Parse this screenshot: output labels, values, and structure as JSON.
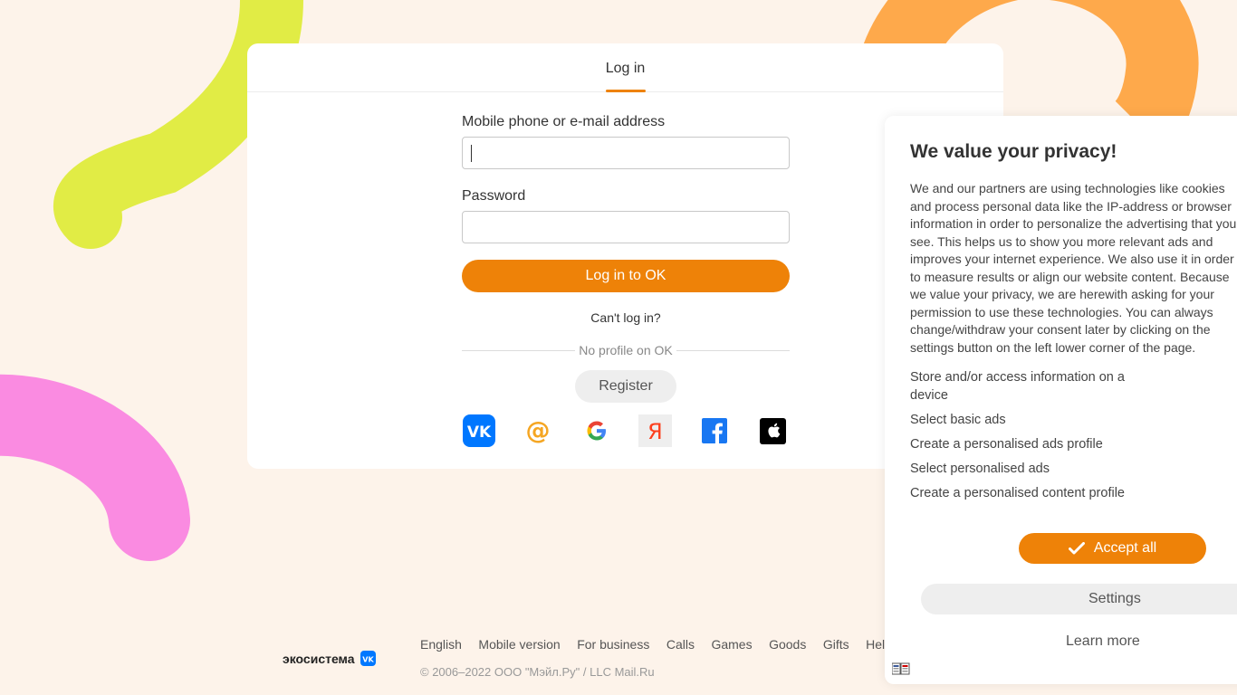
{
  "header": {
    "tab_login": "Log in"
  },
  "form": {
    "phone_label": "Mobile phone or e-mail address",
    "phone_value": "",
    "password_label": "Password",
    "password_value": "",
    "login_button": "Log in to OK",
    "cant_login": "Can't log in?",
    "no_profile": "No profile on OK",
    "register_button": "Register"
  },
  "socials": [
    {
      "name": "vk-icon",
      "color": "#0077ff"
    },
    {
      "name": "mail-at-icon",
      "color": "#f5a623"
    },
    {
      "name": "google-icon",
      "color": "#4285f4"
    },
    {
      "name": "yandex-icon",
      "color": "#fc3f1d"
    },
    {
      "name": "facebook-icon",
      "color": "#1877f2"
    },
    {
      "name": "apple-icon",
      "color": "#000000"
    }
  ],
  "footer": {
    "ecosystem": "экосистема",
    "links": [
      "English",
      "Mobile version",
      "For business",
      "Calls",
      "Games",
      "Goods",
      "Gifts",
      "Help"
    ],
    "copyright": "© 2006–2022 ООО \"Мэйл.Ру\" / LLC Mail.Ru"
  },
  "privacy": {
    "title": "We value your privacy!",
    "body": "We and our partners are using technologies like cookies and process personal data like the IP-address or browser information in order to personalize the advertising that you see. This helps us to show you more relevant ads and improves your internet experience. We also use it in order to measure results or align our website content. Because we value your privacy, we are herewith asking for your permission to use these technologies. You can always change/withdraw your consent later by clicking on the settings button on the left lower corner of the page.",
    "purposes": [
      "Store and/or access information on a device",
      "Select basic ads",
      "Create a personalised ads profile",
      "Select personalised ads",
      "Create a personalised content profile"
    ],
    "accept_button": "Accept all",
    "settings_button": "Settings",
    "learn_more": "Learn more"
  },
  "colors": {
    "accent": "#ee8208",
    "background": "#fdf3ea"
  }
}
